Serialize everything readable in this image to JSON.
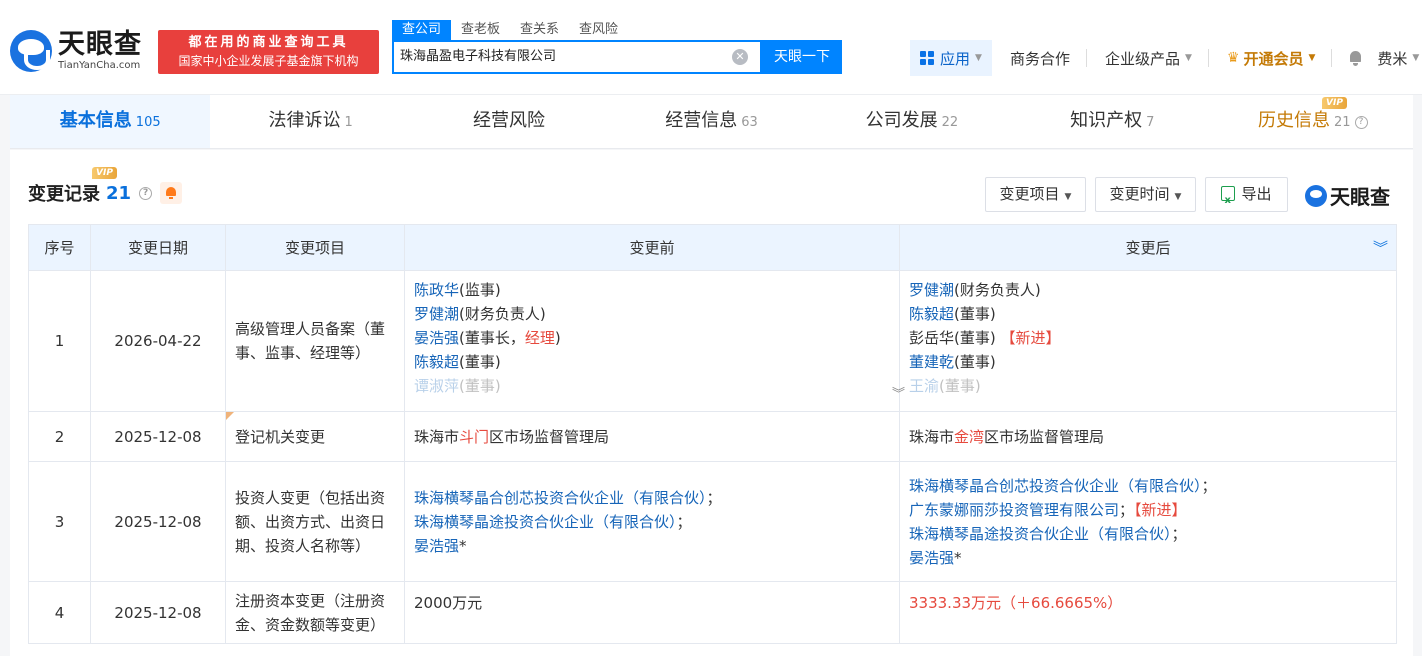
{
  "header": {
    "logo_cn": "天眼查",
    "logo_en": "TianYanCha.com",
    "slogan_line1": "都在用的商业查询工具",
    "slogan_line2": "国家中小企业发展子基金旗下机构",
    "search_tabs": [
      "查公司",
      "查老板",
      "查关系",
      "查风险"
    ],
    "search_value": "珠海晶盈电子科技有限公司",
    "search_button": "天眼一下",
    "nav": {
      "app": "应用",
      "business": "商务合作",
      "enterprise": "企业级产品",
      "vip": "开通会员",
      "user": "费米"
    }
  },
  "tabs": [
    {
      "label": "基本信息",
      "count": "105"
    },
    {
      "label": "法律诉讼",
      "count": "1"
    },
    {
      "label": "经营风险",
      "count": ""
    },
    {
      "label": "经营信息",
      "count": "63"
    },
    {
      "label": "公司发展",
      "count": "22"
    },
    {
      "label": "知识产权",
      "count": "7"
    },
    {
      "label": "历史信息",
      "count": "21"
    }
  ],
  "vip_badge": "VIP",
  "section": {
    "title": "变更记录",
    "count": "21",
    "filter_item": "变更项目",
    "filter_time": "变更时间",
    "export": "导出",
    "brand": "天眼查"
  },
  "table": {
    "headers": [
      "序号",
      "变更日期",
      "变更项目",
      "变更前",
      "变更后"
    ],
    "rows": [
      {
        "no": "1",
        "date": "2026-04-22",
        "item": "高级管理人员备案（董事、监事、经理等）",
        "before": [
          {
            "name": "陈政华",
            "role": "(监事)"
          },
          {
            "name": "罗健潮",
            "role": "(财务负责人)"
          },
          {
            "name": "晏浩强",
            "role_a": "(董事长，",
            "role_red": "经理",
            "role_b": ")"
          },
          {
            "name": "陈毅超",
            "role": "(董事)"
          },
          {
            "name": "谭淑萍",
            "role": "(董事)"
          }
        ],
        "after": [
          {
            "name": "罗健潮",
            "role": "(财务负责人)"
          },
          {
            "name": "陈毅超",
            "role": "(董事)"
          },
          {
            "name": "彭岳华",
            "role": "(董事)",
            "tag": "【新进】"
          },
          {
            "name": "董建乾",
            "role": "(董事)"
          },
          {
            "name": "王渝",
            "role": "(董事)"
          }
        ]
      },
      {
        "no": "2",
        "date": "2025-12-08",
        "item": "登记机关变更",
        "before": {
          "pre": "珠海市",
          "hl": "斗门",
          "post": "区市场监督管理局"
        },
        "after": {
          "pre": "珠海市",
          "hl": "金湾",
          "post": "区市场监督管理局"
        }
      },
      {
        "no": "3",
        "date": "2025-12-08",
        "item": "投资人变更（包括出资额、出资方式、出资日期、投资人名称等）",
        "before": [
          "珠海横琴晶合创芯投资合伙企业（有限合伙）",
          "珠海横琴晶途投资合伙企业（有限合伙）",
          "晏浩强"
        ],
        "after": [
          "珠海横琴晶合创芯投资合伙企业（有限合伙）",
          "广东蒙娜丽莎投资管理有限公司",
          "珠海横琴晶途投资合伙企业（有限合伙）",
          "晏浩强"
        ],
        "sep": "；",
        "star": "*",
        "new_tag": "【新进】"
      },
      {
        "no": "4",
        "date": "2025-12-08",
        "item": "注册资本变更（注册资金、资金数额等变更）",
        "before": "2000万元",
        "after": "3333.33万元（＋66.6665%）"
      }
    ]
  },
  "colors": {
    "accent": "#0084ff",
    "link": "#1765b8",
    "highlight": "#e64a3e",
    "vip": "#c47a06"
  }
}
